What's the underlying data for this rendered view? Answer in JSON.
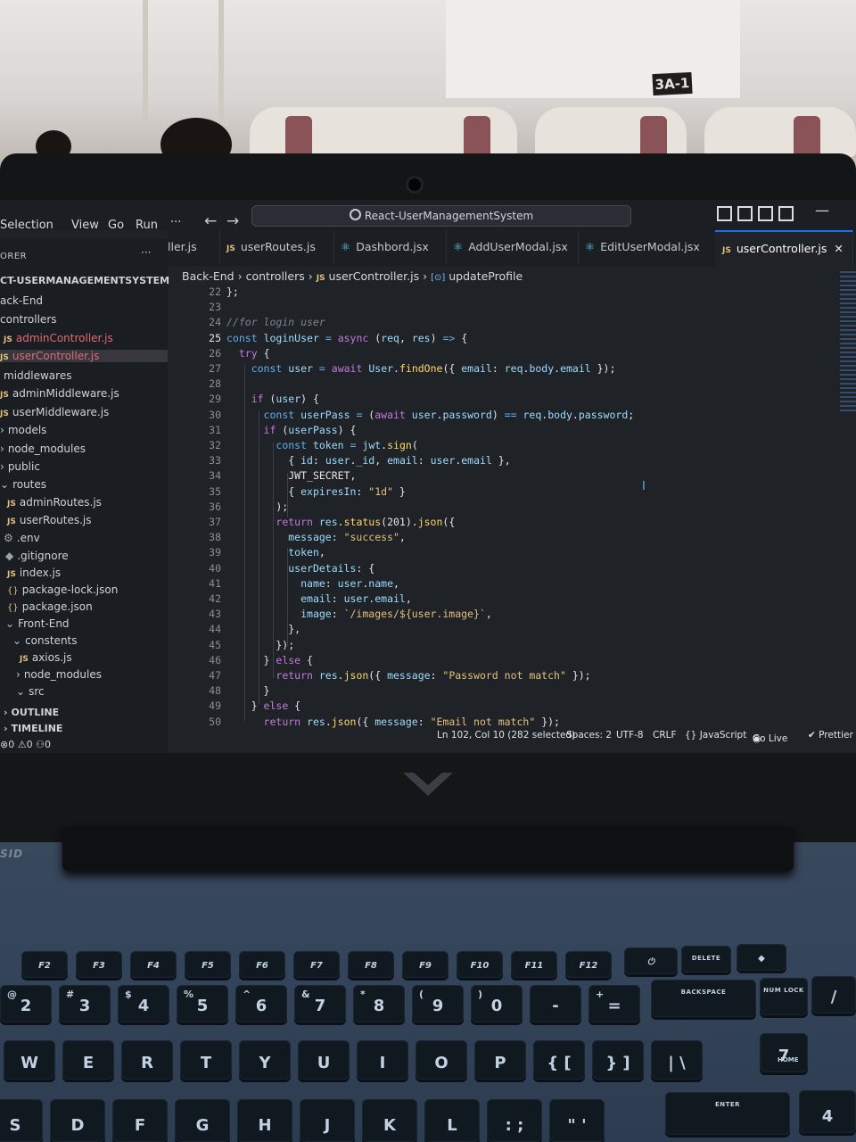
{
  "room": {
    "room_sign": "3A-1"
  },
  "titlebar": {
    "menu": [
      "Selection",
      "View",
      "Go",
      "Run",
      "···"
    ],
    "back": "←",
    "forward": "→",
    "search_text": "React-UserManagementSystem",
    "minimize": "—"
  },
  "sidebar": {
    "header": "ORER",
    "more": "···",
    "project": "CT-USERMANAGEMENTSYSTEM",
    "items": [
      {
        "label": "ack-End"
      },
      {
        "label": "controllers"
      },
      {
        "label": "adminController.js"
      },
      {
        "label": "userController.js"
      },
      {
        "label": "middlewares"
      },
      {
        "label": "adminMiddleware.js"
      },
      {
        "label": "userMiddleware.js"
      },
      {
        "label": "models"
      },
      {
        "label": "node_modules"
      },
      {
        "label": "public"
      },
      {
        "label": "routes"
      },
      {
        "label": "adminRoutes.js"
      },
      {
        "label": "userRoutes.js"
      },
      {
        "label": ".env"
      },
      {
        "label": ".gitignore"
      },
      {
        "label": "index.js"
      },
      {
        "label": "package-lock.json"
      },
      {
        "label": "package.json"
      },
      {
        "label": "Front-End"
      },
      {
        "label": "constents"
      },
      {
        "label": "axios.js"
      },
      {
        "label": "node_modules"
      },
      {
        "label": "src"
      }
    ],
    "outline": "OUTLINE",
    "timeline": "TIMELINE",
    "status": {
      "errors": "0",
      "warnings": "0",
      "ports": "0"
    }
  },
  "tabs": [
    {
      "label": "ller.js"
    },
    {
      "label": "userRoutes.js"
    },
    {
      "label": "Dashbord.jsx"
    },
    {
      "label": "AddUserModal.jsx"
    },
    {
      "label": "EditUserModal.jsx"
    },
    {
      "label": "userController.js"
    }
  ],
  "breadcrumb": {
    "part1": "Back-End",
    "part2": "controllers",
    "part3": "userController.js",
    "part4": "updateProfile"
  },
  "editor": {
    "line_numbers": [
      "22",
      "23",
      "24",
      "25",
      "26",
      "27",
      "28",
      "29",
      "30",
      "31",
      "32",
      "33",
      "34",
      "35",
      "36",
      "37",
      "38",
      "39",
      "40",
      "41",
      "42",
      "43",
      "44",
      "45",
      "46",
      "47",
      "48",
      "49",
      "50"
    ],
    "lines": [
      "};",
      "",
      "//for login user",
      "const loginUser = async (req, res) => {",
      "  try {",
      "    const user = await User.findOne({ email: req.body.email });",
      "",
      "    if (user) {",
      "      const userPass = (await user.password) == req.body.password;",
      "      if (userPass) {",
      "        const token = jwt.sign(",
      "          { id: user._id, email: user.email },",
      "          JWT_SECRET,",
      "          { expiresIn: \"1d\" }",
      "        );",
      "        return res.status(201).json({",
      "          message: \"success\",",
      "          token,",
      "          userDetails: {",
      "            name: user.name,",
      "            email: user.email,",
      "            image: `/images/${user.image}`,",
      "          },",
      "        });",
      "      } else {",
      "        return res.json({ message: \"Password not match\" });",
      "      }",
      "    } else {",
      "      return res.json({ message: \"Email not match\" });"
    ]
  },
  "statusbar": {
    "position": "Ln 102, Col 10 (282 selected)",
    "spaces": "Spaces: 2",
    "encoding": "UTF-8",
    "eol": "CRLF",
    "language": "{} JavaScript",
    "golive": "Go Live",
    "prettier": "✔ Prettier"
  },
  "laptop": {
    "brand": "SID",
    "fn_keys": [
      "F2",
      "F3",
      "F4",
      "F5",
      "F6",
      "F7",
      "F8",
      "F9",
      "F10",
      "F11",
      "F12"
    ],
    "fn_extra": [
      "DELETE"
    ],
    "num_keys": [
      {
        "top": "@",
        "main": "2"
      },
      {
        "top": "#",
        "main": "3"
      },
      {
        "top": "$",
        "main": "4"
      },
      {
        "top": "%",
        "main": "5"
      },
      {
        "top": "^",
        "main": "6"
      },
      {
        "top": "&",
        "main": "7"
      },
      {
        "top": "*",
        "main": "8"
      },
      {
        "top": "(",
        "main": "9"
      },
      {
        "top": ")",
        "main": "0"
      },
      {
        "top": "",
        "main": "-"
      },
      {
        "top": "+",
        "main": "="
      }
    ],
    "backspace": "BACKSPACE",
    "numlock": "NUM LOCK",
    "slash": "/",
    "q_row": [
      "W",
      "E",
      "R",
      "T",
      "Y",
      "U",
      "I",
      "O",
      "P",
      "{ [",
      "} ]",
      "| \\"
    ],
    "home": "HOME",
    "num7": "7",
    "a_row": [
      "S",
      "D",
      "F",
      "G",
      "H",
      "J",
      "K",
      "L",
      ": ;",
      "\" '"
    ],
    "enter": "ENTER",
    "num4": "4"
  }
}
